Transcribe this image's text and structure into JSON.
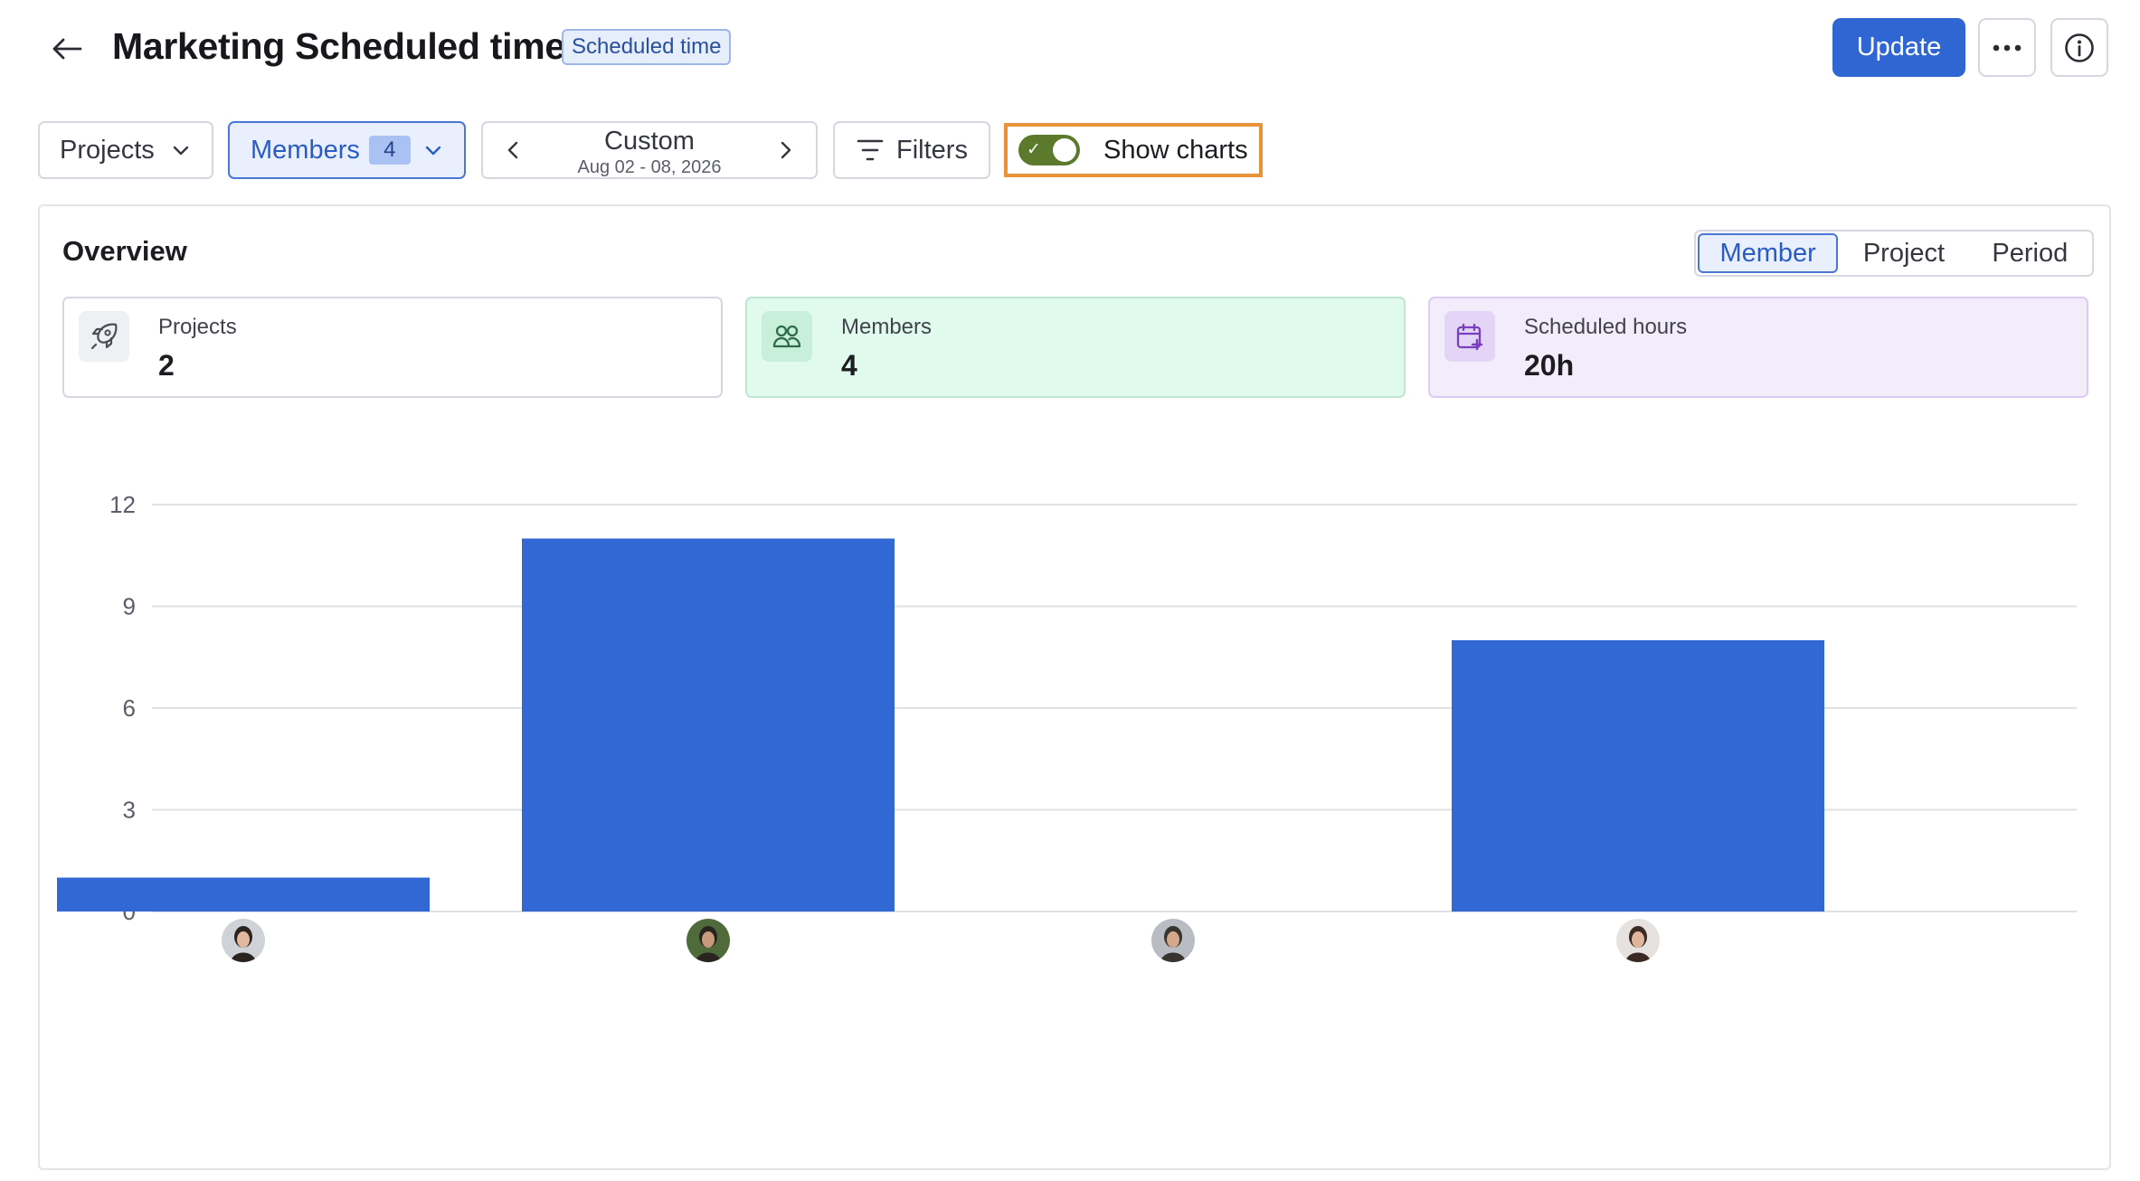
{
  "header": {
    "title": "Marketing Scheduled time",
    "type_badge": "Scheduled time",
    "update_label": "Update"
  },
  "toolbar": {
    "projects_label": "Projects",
    "members_label": "Members",
    "members_count": "4",
    "date_label": "Custom",
    "date_range": "Aug 02 - 08, 2026",
    "filters_label": "Filters",
    "show_charts_label": "Show charts",
    "show_charts_on": true
  },
  "overview": {
    "title": "Overview",
    "view_tabs": [
      "Member",
      "Project",
      "Period"
    ],
    "active_view": "Member",
    "cards": {
      "projects": {
        "label": "Projects",
        "value": "2"
      },
      "members": {
        "label": "Members",
        "value": "4"
      },
      "hours": {
        "label": "Scheduled hours",
        "value": "20h"
      }
    }
  },
  "colors": {
    "accent": "#2f66d2",
    "bar": "#3268d4",
    "highlight": "#e8923a",
    "toggle_on": "#5b7a2c"
  },
  "chart_data": {
    "type": "bar",
    "categories": [
      "member-1",
      "member-2",
      "member-3",
      "member-4"
    ],
    "category_display": "avatar",
    "values": [
      1,
      11,
      0,
      8
    ],
    "ylim": [
      0,
      12
    ],
    "yticks": [
      0,
      3,
      6,
      9,
      12
    ],
    "grid": true
  }
}
